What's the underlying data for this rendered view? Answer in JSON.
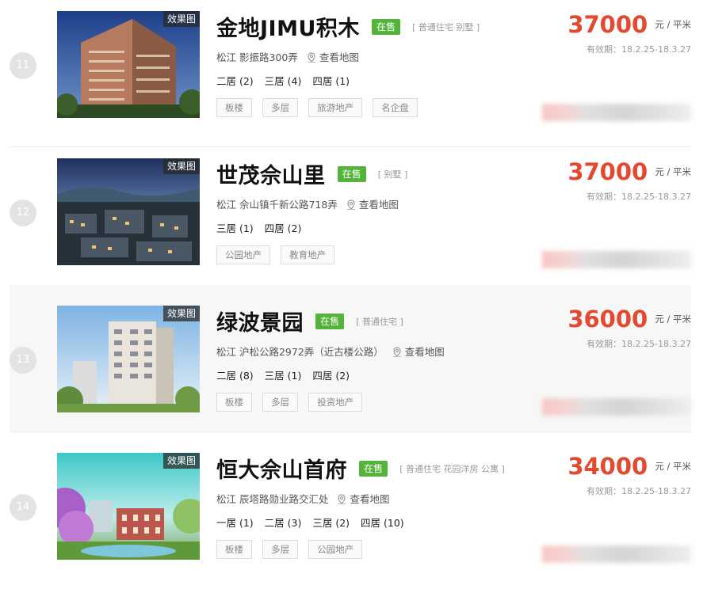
{
  "badge_label": "效果图",
  "map_label": "查看地图",
  "unit_label": "元 / 平米",
  "colors": {
    "price": "#e44930",
    "status": "#53b33a"
  },
  "items": [
    {
      "rank": "11",
      "title": "金地JIMU积木",
      "status": "在售",
      "types": "[ 普通住宅 别墅 ]",
      "address": "松江 影振路300弄",
      "rooms": [
        "二居 (2)",
        "三居 (4)",
        "四居 (1)"
      ],
      "tags": [
        "板楼",
        "多层",
        "旅游地产",
        "名企盘"
      ],
      "price": "37000",
      "valid": "有效期：18.2.25-18.3.27"
    },
    {
      "rank": "12",
      "title": "世茂佘山里",
      "status": "在售",
      "types": "[ 别墅 ]",
      "address": "松江 佘山镇千新公路718弄",
      "rooms": [
        "三居 (1)",
        "四居 (2)"
      ],
      "tags": [
        "公园地产",
        "教育地产"
      ],
      "price": "37000",
      "valid": "有效期：18.2.25-18.3.27"
    },
    {
      "rank": "13",
      "title": "绿波景园",
      "status": "在售",
      "types": "[ 普通住宅 ]",
      "address": "松江 沪松公路2972弄（近古楼公路）",
      "rooms": [
        "二居 (8)",
        "三居 (1)",
        "四居 (2)"
      ],
      "tags": [
        "板楼",
        "多层",
        "投资地产"
      ],
      "price": "36000",
      "valid": "有效期：18.2.25-18.3.27"
    },
    {
      "rank": "14",
      "title": "恒大佘山首府",
      "status": "在售",
      "types": "[ 普通住宅 花园洋房 公寓 ]",
      "address": "松江 辰塔路勋业路交汇处",
      "rooms": [
        "一居 (1)",
        "二居 (3)",
        "三居 (2)",
        "四居 (10)"
      ],
      "tags": [
        "板楼",
        "多层",
        "公园地产"
      ],
      "price": "34000",
      "valid": "有效期：18.2.25-18.3.27"
    }
  ]
}
